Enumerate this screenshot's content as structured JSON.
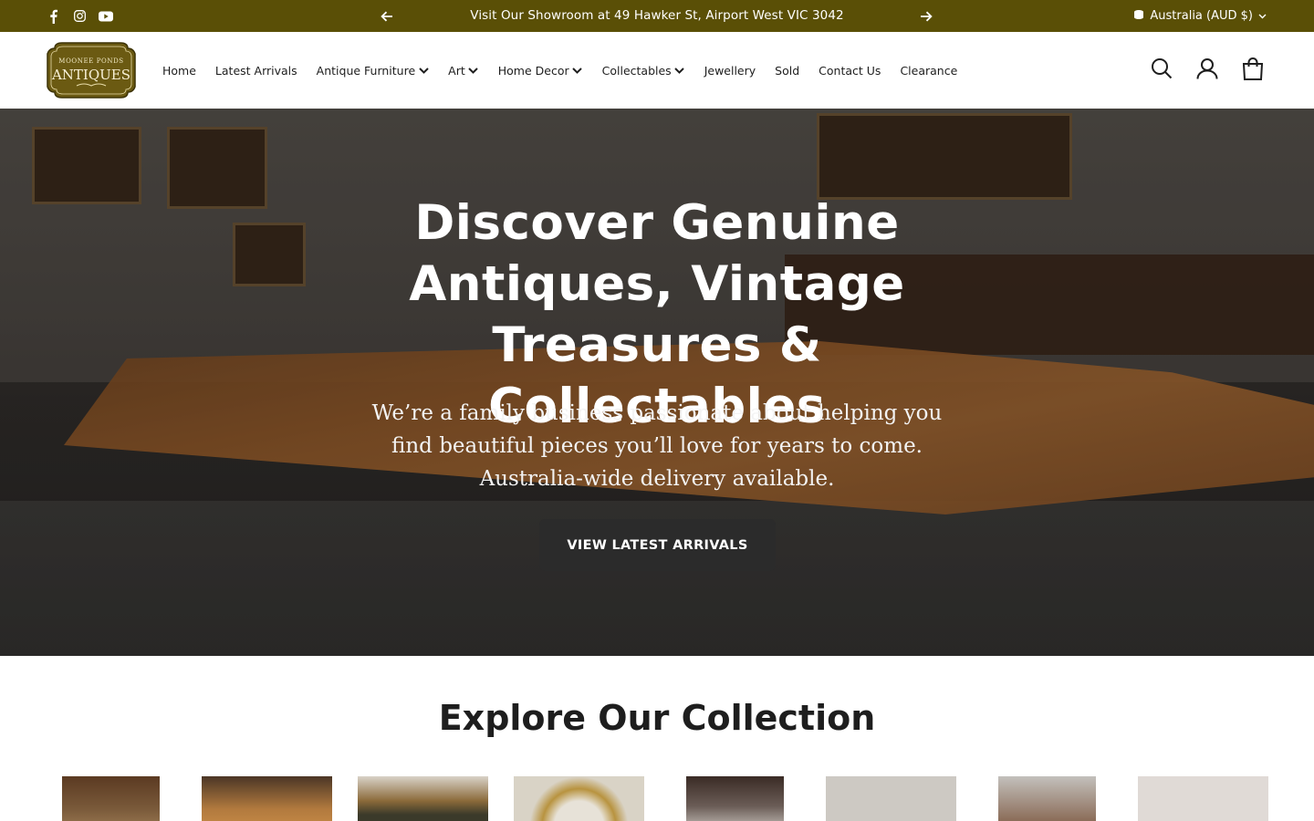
{
  "announcement": {
    "text": "Visit Our Showroom at 49 Hawker St, Airport West VIC 3042",
    "social": [
      "facebook-icon",
      "instagram-icon",
      "youtube-icon"
    ],
    "locale": "Australia (AUD $)"
  },
  "header": {
    "logo_small": "MOONEE PONDS",
    "logo_big": "ANTIQUES",
    "nav": [
      {
        "label": "Home",
        "dropdown": false
      },
      {
        "label": "Latest Arrivals",
        "dropdown": false
      },
      {
        "label": "Antique Furniture",
        "dropdown": true
      },
      {
        "label": "Art",
        "dropdown": true
      },
      {
        "label": "Home Decor",
        "dropdown": true
      },
      {
        "label": "Collectables",
        "dropdown": true
      },
      {
        "label": "Jewellery",
        "dropdown": false
      },
      {
        "label": "Sold",
        "dropdown": false
      },
      {
        "label": "Contact Us",
        "dropdown": false
      },
      {
        "label": "Clearance",
        "dropdown": false
      }
    ],
    "icons": [
      "search-icon",
      "account-icon",
      "cart-icon"
    ]
  },
  "hero": {
    "title": "Discover Genuine Antiques, Vintage Treasures & Collectables",
    "subtitle": "We’re a family business passionate about helping you find beautiful pieces you’ll love for years to come. Australia-wide delivery available.",
    "cta": "VIEW LATEST ARRIVALS"
  },
  "collection": {
    "title": "Explore Our Collection"
  },
  "colors": {
    "announcement_bg": "#5a4f06",
    "button_bg": "#2b2b2b",
    "logo_gold": "#6b5a12"
  }
}
